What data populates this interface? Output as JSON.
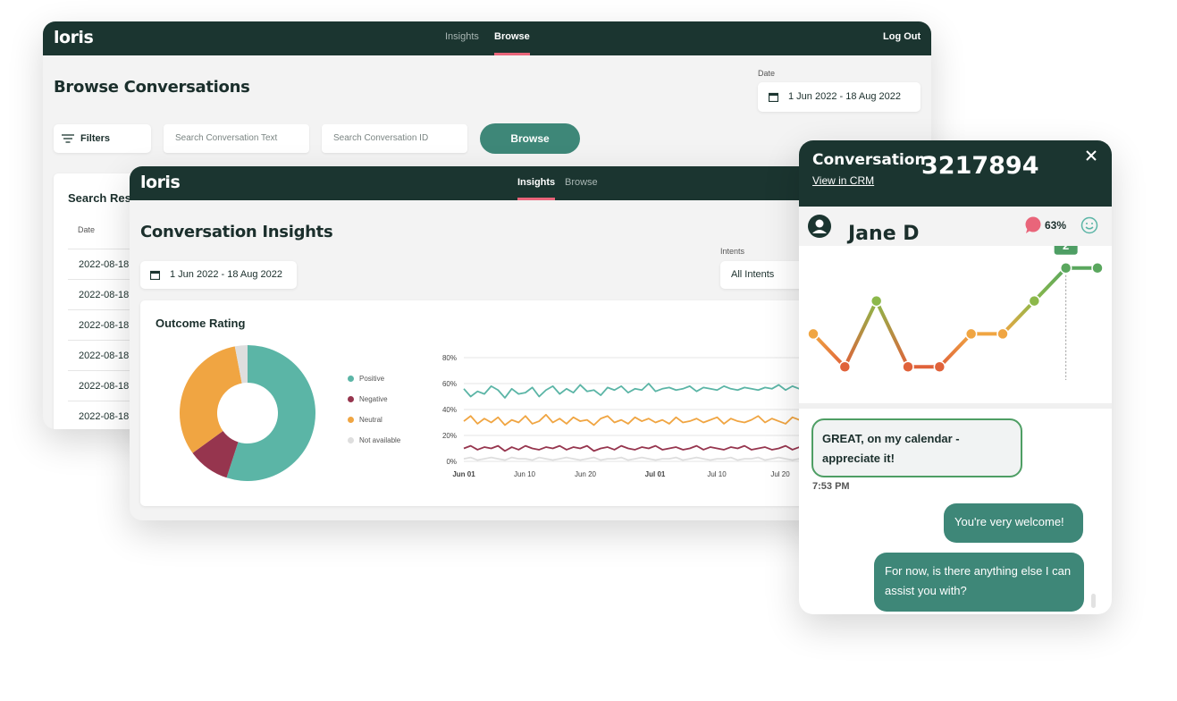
{
  "browse": {
    "logo": "loris",
    "nav": [
      "Insights",
      "Browse"
    ],
    "logout": "Log Out",
    "title": "Browse Conversations",
    "date_label": "Date",
    "date_range": "1 Jun 2022 - 18 Aug 2022",
    "filters_label": "Filters",
    "search_text_placeholder": "Search Conversation Text",
    "search_id_placeholder": "Search Conversation ID",
    "browse_button": "Browse",
    "results_title": "Search Res",
    "date_col": "Date",
    "rows": [
      "2022-08-18",
      "2022-08-18",
      "2022-08-18",
      "2022-08-18",
      "2022-08-18",
      "2022-08-18"
    ]
  },
  "insights": {
    "logo": "loris",
    "nav": [
      "Insights",
      "Browse"
    ],
    "title": "Conversation Insights",
    "date_range": "1 Jun 2022 - 18 Aug 2022",
    "intents_label": "Intents",
    "intents_value": "All Intents",
    "outcome_title": "Outcome Rating",
    "legend": [
      "Positive",
      "Negative",
      "Neutral",
      "Not available"
    ],
    "colors": {
      "positive": "#5bb5a6",
      "negative": "#96354e",
      "neutral": "#f0a542",
      "not_available": "#dedede"
    }
  },
  "chart_data": [
    {
      "type": "pie",
      "categories": [
        "Positive",
        "Negative",
        "Neutral",
        "Not available"
      ],
      "values": [
        55,
        10,
        32,
        3
      ]
    },
    {
      "type": "line",
      "x": [
        "Jun 01",
        "Jun 10",
        "Jun 20",
        "Jul 01",
        "Jul 10",
        "Jul 20"
      ],
      "ylim": [
        0,
        80
      ],
      "yticks": [
        "80%",
        "60%",
        "40%",
        "20%",
        "0%"
      ],
      "grid": true,
      "series": [
        {
          "name": "Positive",
          "values": [
            56,
            50,
            54,
            52,
            58,
            55,
            49,
            56,
            52,
            53,
            57,
            50,
            55,
            58,
            52,
            56,
            53,
            59,
            54,
            55,
            51,
            57,
            55,
            58,
            53,
            56,
            55,
            60,
            54,
            56,
            57,
            55,
            56,
            58,
            54,
            57,
            56,
            55,
            58,
            56,
            55,
            57,
            56,
            55,
            57,
            56,
            59,
            55,
            58,
            56,
            57,
            60,
            55,
            57
          ]
        },
        {
          "name": "Neutral",
          "values": [
            31,
            35,
            29,
            33,
            30,
            34,
            28,
            32,
            30,
            35,
            29,
            31,
            36,
            30,
            33,
            29,
            34,
            31,
            32,
            28,
            33,
            35,
            30,
            32,
            29,
            34,
            31,
            33,
            30,
            32,
            29,
            34,
            30,
            31,
            33,
            30,
            32,
            34,
            29,
            33,
            31,
            30,
            32,
            35,
            30,
            33,
            31,
            29,
            34,
            32,
            30,
            33,
            31,
            32
          ]
        },
        {
          "name": "Negative",
          "values": [
            10,
            12,
            9,
            11,
            10,
            12,
            8,
            11,
            9,
            12,
            10,
            9,
            11,
            10,
            12,
            9,
            11,
            10,
            12,
            8,
            10,
            11,
            9,
            12,
            10,
            9,
            11,
            10,
            12,
            9,
            10,
            11,
            9,
            10,
            12,
            9,
            11,
            10,
            9,
            11,
            10,
            12,
            9,
            10,
            11,
            9,
            10,
            12,
            9,
            11,
            10,
            9,
            11,
            10
          ]
        },
        {
          "name": "Not available",
          "values": [
            2,
            3,
            1,
            2,
            3,
            2,
            1,
            3,
            2,
            2,
            1,
            3,
            2,
            1,
            2,
            3,
            2,
            1,
            2,
            3,
            1,
            2,
            2,
            3,
            1,
            2,
            3,
            2,
            1,
            2,
            2,
            3,
            1,
            2,
            3,
            2,
            1,
            2,
            2,
            3,
            1,
            2,
            2,
            3,
            1,
            2,
            3,
            2,
            1,
            2,
            2,
            3,
            1,
            2
          ]
        }
      ]
    },
    {
      "type": "line",
      "values": [
        0,
        -1,
        1,
        -1,
        -1,
        0,
        0,
        1,
        2,
        2
      ],
      "colors": [
        "#f0a542",
        "#e0623a",
        "#8cb84a",
        "#e0623a",
        "#e0623a",
        "#f0a542",
        "#f0a542",
        "#8cb84a",
        "#5aa75e",
        "#5aa75e"
      ],
      "highlight_label": "2",
      "ylim": [
        -1.4,
        2.4
      ]
    }
  ],
  "conversation": {
    "label": "Conversation",
    "id": "3217894",
    "crm_link": "View in CRM",
    "name": "Jane D",
    "sentiment_pct": "63%",
    "messages": [
      {
        "side": "left",
        "text": "GREAT, on my calendar - appreciate it!",
        "time": "7:53 PM"
      },
      {
        "side": "right",
        "text": "You're very welcome!"
      },
      {
        "side": "right",
        "text": "For now, is there anything else I can assist you with?"
      }
    ]
  }
}
